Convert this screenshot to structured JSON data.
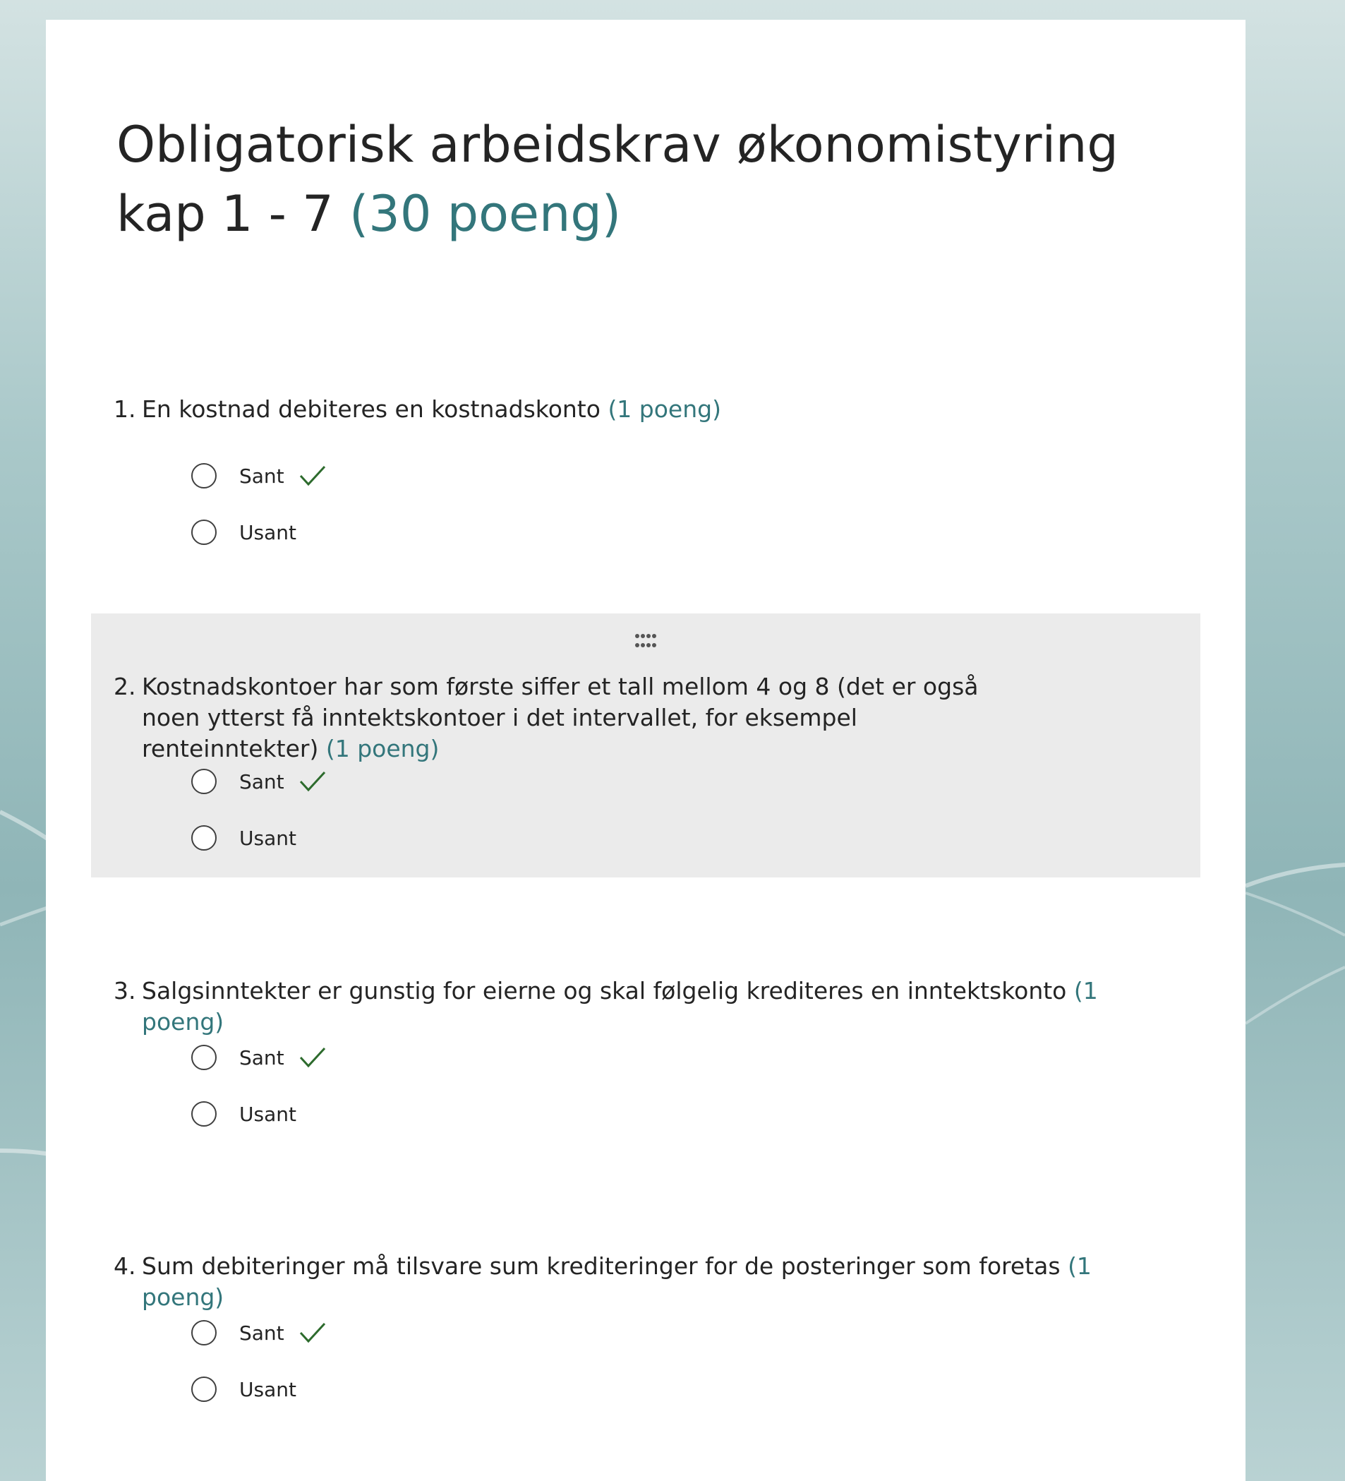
{
  "form": {
    "title": "Obligatorisk arbeidskrav økonomistyring kap 1 - 7",
    "total_points": "(30 poeng)"
  },
  "colors": {
    "accent": "#33767b",
    "correct_check": "#2d6b2d",
    "active_question_bg": "#ebebeb"
  },
  "questions": [
    {
      "number": "1.",
      "text": "En kostnad debiteres en kostnadskonto",
      "points": "(1 poeng)",
      "options": [
        {
          "label": "Sant",
          "correct": true
        },
        {
          "label": "Usant",
          "correct": false
        }
      ]
    },
    {
      "number": "2.",
      "text": "Kostnadskontoer har som første siffer et tall mellom 4 og 8 (det er også noen ytterst få inntektskontoer i det intervallet, for eksempel renteinntekter)",
      "points": "(1 poeng)",
      "options": [
        {
          "label": "Sant",
          "correct": true
        },
        {
          "label": "Usant",
          "correct": false
        }
      ]
    },
    {
      "number": "3.",
      "text": "Salgsinntekter er gunstig for eierne og skal følgelig krediteres en inntektskonto",
      "points": "(1 poeng)",
      "options": [
        {
          "label": "Sant",
          "correct": true
        },
        {
          "label": "Usant",
          "correct": false
        }
      ]
    },
    {
      "number": "4.",
      "text": "Sum debiteringer må tilsvare sum krediteringer for de posteringer som foretas",
      "points": "(1 poeng)",
      "options": [
        {
          "label": "Sant",
          "correct": true
        },
        {
          "label": "Usant",
          "correct": false
        }
      ]
    }
  ]
}
